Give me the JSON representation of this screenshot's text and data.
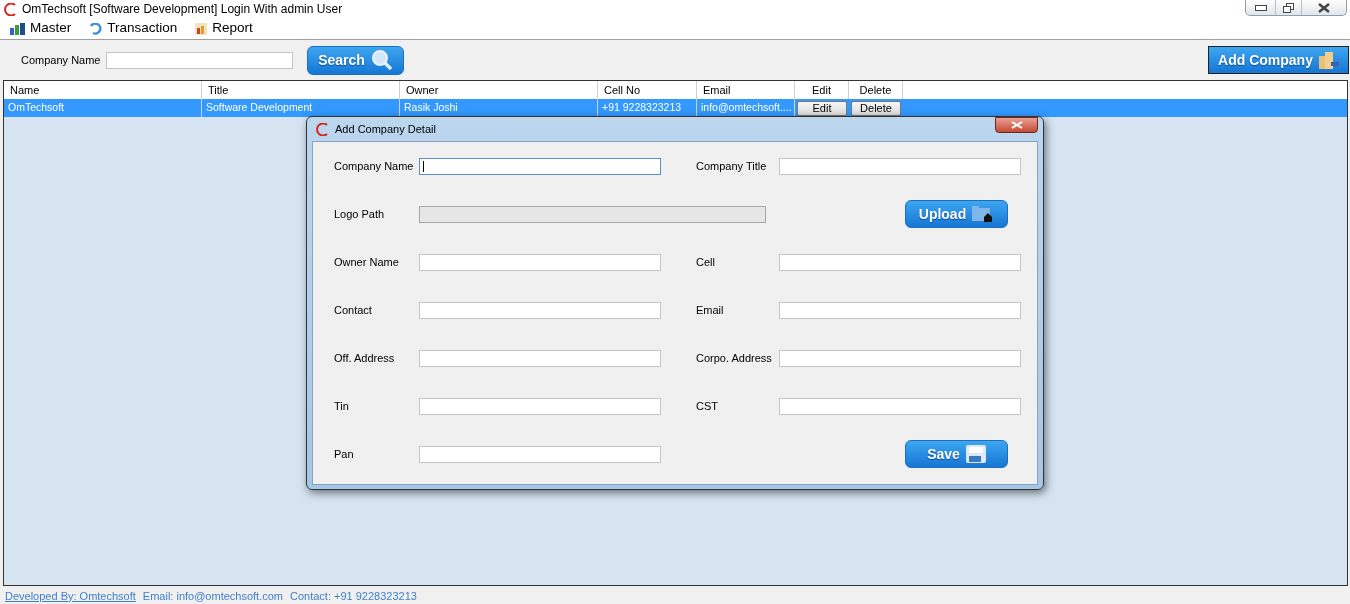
{
  "window": {
    "title": "OmTechsoft [Software Development] Login With admin User"
  },
  "menu": [
    {
      "label": "Master",
      "kind": "master"
    },
    {
      "label": "Transaction",
      "kind": "transaction"
    },
    {
      "label": "Report",
      "kind": "report"
    }
  ],
  "search": {
    "label": "Company Name",
    "button": "Search"
  },
  "add_button": "Add Company",
  "table": {
    "columns": [
      "Name",
      "Title",
      "Owner",
      "Cell No",
      "Email",
      "Edit",
      "Delete"
    ],
    "rows": [
      {
        "selected": true,
        "cells": [
          "OmTechsoft",
          "Software Development",
          "Rasik Joshi",
          "+91 9228323213",
          "info@omtechsoft...."
        ],
        "edit": "Edit",
        "delete": "Delete"
      }
    ]
  },
  "dialog": {
    "title": "Add Company Detail",
    "rows": [
      [
        {
          "kind": "field",
          "label": "Company Name",
          "focused": true,
          "disabled": false
        },
        {
          "kind": "field",
          "label": "Company Title",
          "focused": false,
          "disabled": false
        }
      ],
      [
        {
          "kind": "wide_field",
          "label": "Logo Path",
          "focused": false,
          "disabled": true
        },
        {
          "kind": "button",
          "label": "Upload"
        }
      ],
      [
        {
          "kind": "field",
          "label": "Owner Name",
          "focused": false,
          "disabled": false
        },
        {
          "kind": "field",
          "label": "Cell",
          "focused": false,
          "disabled": false
        }
      ],
      [
        {
          "kind": "field",
          "label": "Contact",
          "focused": false,
          "disabled": false
        },
        {
          "kind": "field",
          "label": "Email",
          "focused": false,
          "disabled": false
        }
      ],
      [
        {
          "kind": "field",
          "label": "Off. Address",
          "focused": false,
          "disabled": false
        },
        {
          "kind": "field",
          "label": "Corpo. Address",
          "focused": false,
          "disabled": false
        }
      ],
      [
        {
          "kind": "field",
          "label": "Tin",
          "focused": false,
          "disabled": false
        },
        {
          "kind": "field",
          "label": "CST",
          "focused": false,
          "disabled": false
        }
      ],
      [
        {
          "kind": "field",
          "label": "Pan",
          "focused": false,
          "disabled": false
        },
        {
          "kind": "button",
          "label": "Save"
        }
      ]
    ]
  },
  "footer": {
    "link": "Developed By: Omtechsoft",
    "email": "Email: info@omtechsoft.com",
    "contact": "Contact: +91 9228323213"
  }
}
